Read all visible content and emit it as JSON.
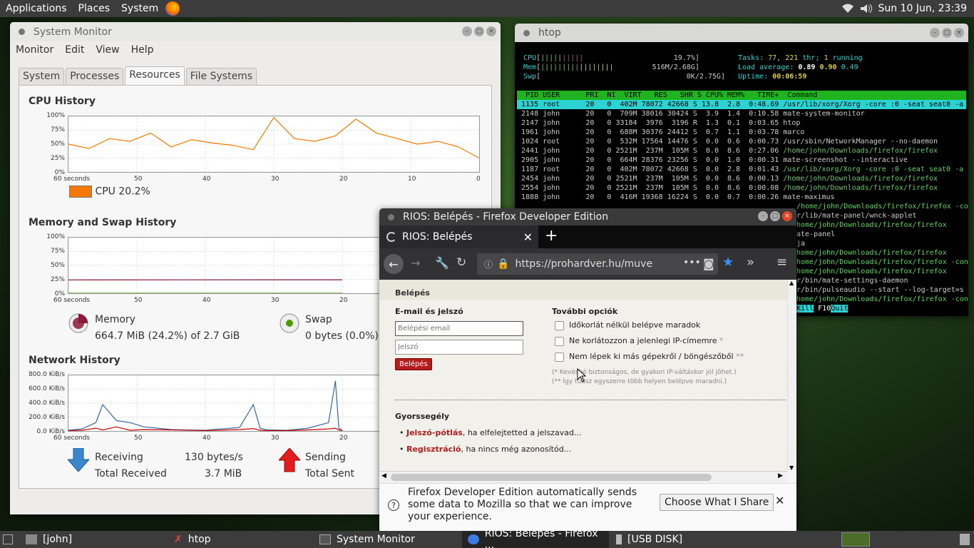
{
  "topbar": {
    "menus": [
      "Applications",
      "Places",
      "System"
    ],
    "datetime": "Sun 10 Jun, 23:39"
  },
  "sysmon": {
    "title": "System Monitor",
    "menu": [
      "Monitor",
      "Edit",
      "View",
      "Help"
    ],
    "tabs": [
      "System",
      "Processes",
      "Resources",
      "File Systems"
    ],
    "active_tab": "Resources",
    "cpu": {
      "title": "CPU History",
      "legend": "CPU",
      "value": "20.2%",
      "color": "#f57900"
    },
    "memory": {
      "title": "Memory and Swap History",
      "mem_label": "Memory",
      "mem_value": "664.7 MiB (24.2%) of 2.7 GiB",
      "mem_percent": 24.2,
      "swap_label": "Swap",
      "swap_value": "0 bytes (0.0%) o",
      "mem_color": "#8b1a3a",
      "swap_color": "#4e9a06"
    },
    "network": {
      "title": "Network History",
      "receiving_label": "Receiving",
      "receiving_value": "130 bytes/s",
      "total_received_label": "Total Received",
      "total_received_value": "3.7 MiB",
      "sending_label": "Sending",
      "total_sent_label": "Total Sent",
      "rx_color": "#3465a4",
      "tx_color": "#cc0000"
    },
    "pct_ticks": [
      "100%",
      "75%",
      "50%",
      "25%",
      "0%"
    ],
    "net_ticks": [
      "800.0 KiB/s",
      "600.0 KiB/s",
      "400.0 KiB/s",
      "200.0 KiB/s",
      "0.0 KiB/s"
    ],
    "x_ticks": [
      "60 seconds",
      "50",
      "40",
      "30",
      "20",
      "10",
      "0"
    ]
  },
  "chart_data": [
    {
      "type": "line",
      "title": "CPU History",
      "xlabel": "",
      "ylabel": "",
      "x": [
        60,
        57,
        54,
        51,
        48,
        45,
        42,
        39,
        36,
        33,
        30,
        27,
        24,
        21,
        18,
        15,
        12,
        9,
        6,
        3,
        0
      ],
      "series": [
        {
          "name": "CPU",
          "values": [
            50,
            42,
            60,
            55,
            70,
            45,
            58,
            52,
            48,
            40,
            98,
            60,
            55,
            65,
            95,
            70,
            60,
            50,
            55,
            45,
            25
          ]
        }
      ],
      "ylim": [
        0,
        100
      ],
      "grid": true
    },
    {
      "type": "line",
      "title": "Memory and Swap History",
      "x": [
        60,
        30,
        20
      ],
      "series": [
        {
          "name": "Memory",
          "values": [
            24,
            24.2,
            24.2
          ]
        },
        {
          "name": "Swap",
          "values": [
            0,
            0,
            0
          ]
        }
      ],
      "ylim": [
        0,
        100
      ],
      "grid": true
    },
    {
      "type": "line",
      "title": "Network History",
      "x": [
        60,
        58,
        56,
        55,
        53,
        51,
        49,
        45,
        40,
        35,
        33,
        32,
        31,
        28,
        25,
        22,
        21,
        20.5,
        20
      ],
      "series": [
        {
          "name": "Receiving",
          "values": [
            10,
            30,
            120,
            380,
            150,
            120,
            60,
            20,
            10,
            50,
            380,
            40,
            15,
            10,
            40,
            120,
            720,
            40,
            10
          ]
        },
        {
          "name": "Sending",
          "values": [
            5,
            10,
            40,
            15,
            60,
            10,
            20,
            15,
            5,
            20,
            35,
            10,
            5,
            5,
            15,
            30,
            40,
            15,
            5
          ]
        }
      ],
      "ylim": [
        0,
        800
      ],
      "grid": true
    }
  ],
  "htop": {
    "title": "htop",
    "cpu_line": "19.7%]",
    "mem_line": "516M/2.68G]",
    "swp_line": "0K/2.75G]",
    "tasks_text": "Tasks:",
    "tasks_val": "77, 221",
    "thr_text": "thr;",
    "running_val": "1",
    "running_text": "running",
    "load_text": "Load average:",
    "load_1": "0.89",
    "load_5": "0.90",
    "load_15": "0.49",
    "uptime_text": "Uptime:",
    "uptime_val": "00:06:59",
    "header": "  PID USER      PRI  NI  VIRT   RES   SHR S CPU% MEM%   TIME+  Command",
    "rows": [
      [
        "1135",
        "root",
        "20",
        "0",
        "402M",
        "78072",
        "42668",
        "S",
        "13.8",
        "2.8",
        "0:48.69",
        "/usr/lib/xorg/Xorg -core :0 -seat seat0 -a"
      ],
      [
        "2148",
        "john",
        "20",
        "0",
        "709M",
        "38016",
        "30424",
        "S",
        "3.9",
        "1.4",
        "0:10.58",
        "mate-system-monitor"
      ],
      [
        "2147",
        "john",
        "20",
        "0",
        "33184",
        "3976",
        "3196",
        "R",
        "1.3",
        "0.1",
        "0:03.65",
        "htop"
      ],
      [
        "1961",
        "john",
        "20",
        "0",
        "688M",
        "30376",
        "24412",
        "S",
        "0.7",
        "1.1",
        "0:03.78",
        "marco"
      ],
      [
        "1024",
        "root",
        "20",
        "0",
        "532M",
        "17564",
        "14476",
        "S",
        "0.0",
        "0.6",
        "0:00.73",
        "/usr/sbin/NetworkManager --no-daemon"
      ],
      [
        "2441",
        "john",
        "20",
        "0",
        "2521M",
        "237M",
        "105M",
        "S",
        "0.0",
        "8.6",
        "0:27.06",
        "/home/john/Downloads/firefox/firefox"
      ],
      [
        "2905",
        "john",
        "20",
        "0",
        "664M",
        "28376",
        "23256",
        "S",
        "0.0",
        "1.0",
        "0:00.31",
        "mate-screenshot --interactive"
      ],
      [
        "1187",
        "root",
        "20",
        "0",
        "402M",
        "78072",
        "42668",
        "S",
        "0.0",
        "2.8",
        "0:01.43",
        "/usr/lib/xorg/Xorg -core :0 -seat seat0 -a"
      ],
      [
        "2454",
        "john",
        "20",
        "0",
        "2521M",
        "237M",
        "105M",
        "S",
        "0.0",
        "8.6",
        "0:00.13",
        "/home/john/Downloads/firefox/firefox"
      ],
      [
        "2554",
        "john",
        "20",
        "0",
        "2521M",
        "237M",
        "105M",
        "S",
        "0.0",
        "8.6",
        "0:00.08",
        "/home/john/Downloads/firefox/firefox"
      ],
      [
        "1888",
        "john",
        "20",
        "0",
        "416M",
        "19368",
        "16224",
        "S",
        "0.0",
        "0.7",
        "0:00.26",
        "mate-maximus"
      ]
    ],
    "right_rows": [
      "/home/john/Downloads/firefox/firefox -cont",
      "r/lib/mate-panel/wnck-applet",
      "home/john/Downloads/firefox/firefox",
      "ate-panel",
      "ja",
      "home/john/Downloads/firefox/firefox",
      "home/john/Downloads/firefox/firefox -cont",
      "home/john/Downloads/firefox/firefox",
      "r/bin/mate-settings-daemon",
      "r/bin/pulseaudio --start --log-target=s",
      "home/john/Downloads/firefox/firefox -cont"
    ],
    "footer_kill": "Kill",
    "footer_f10": "F10",
    "footer_quit": "Quit"
  },
  "firefox": {
    "title": "RIOS: Belépés - Firefox Developer Edition",
    "tab_title": "RIOS: Belépés",
    "url": "https://prohardver.hu/muve",
    "content": {
      "section": "Belépés",
      "email_heading": "E-mail és jelszó",
      "email_placeholder": "Belépési email",
      "password_placeholder": "Jelszó",
      "login_button": "Belépés",
      "options_heading": "További opciók",
      "opt1": "Időkorlát nélkül belépve maradok",
      "opt2": "Ne korlátozzon a jelenlegi IP-címemre",
      "opt2_star": "*",
      "opt3": "Nem lépek ki más gépekről / böngészőből",
      "opt3_star": "**",
      "note1": "(* Kevésbé biztonságos, de gyakori IP-váltáskor jól jöhet.)",
      "note2": "(** Így tudsz egyszerre több helyen belépve maradni.)",
      "help_heading": "Gyorssegély",
      "help1_link": "Jelszó-pótlás",
      "help1_text": ", ha elfelejtetted a jelszavad...",
      "help2_link": "Regisztráció",
      "help2_text": ", ha nincs még azonosítód..."
    },
    "notice": "Firefox Developer Edition automatically sends some data to Mozilla so that we can improve your experience.",
    "notice_button": "Choose What I Share"
  },
  "taskbar": {
    "items": [
      "[john]",
      "htop",
      "System Monitor",
      "RIOS: Belépés - Firefox ...",
      "[USB DISK]"
    ]
  }
}
